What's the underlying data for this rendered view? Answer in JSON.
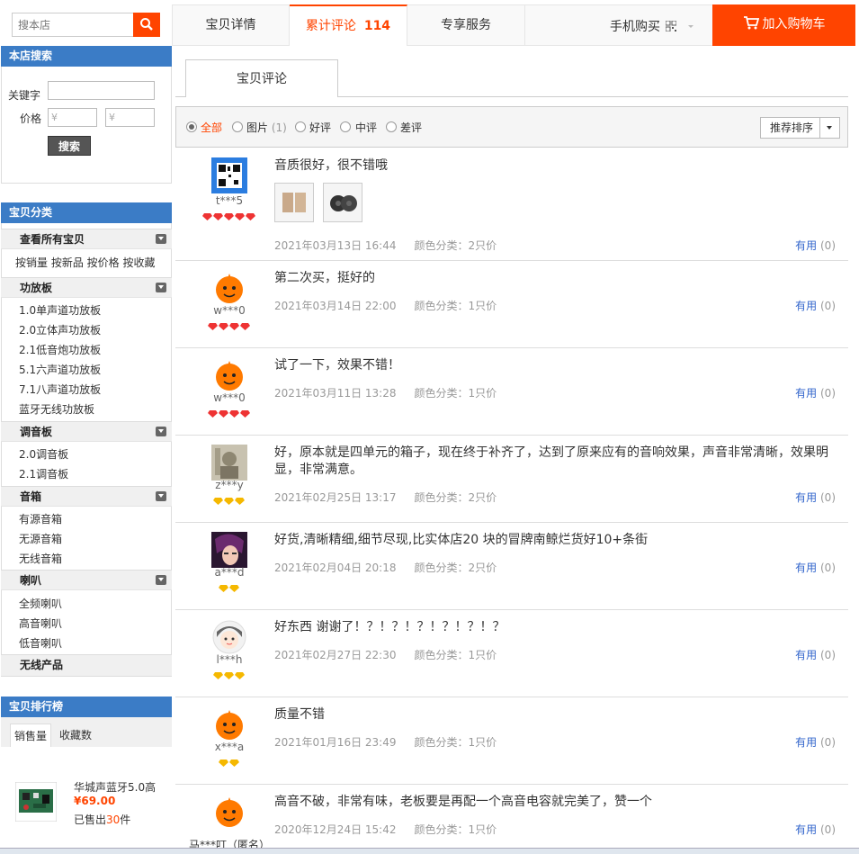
{
  "left": {
    "search_placeholder": "搜本店",
    "shop_search": {
      "title": "本店搜索",
      "keyword_label": "关键字",
      "price_label": "价格",
      "price_min_placeholder": "¥",
      "price_max_placeholder": "¥",
      "button": "搜索"
    },
    "category": {
      "title": "宝贝分类",
      "all_items": "查看所有宝贝",
      "sort_links": "按销量 按新品 按价格 按收藏",
      "groups": [
        {
          "name": "功放板",
          "items": [
            "1.0单声道功放板",
            "2.0立体声功放板",
            "2.1低音炮功放板",
            "5.1六声道功放板",
            "7.1八声道功放板",
            "蓝牙无线功放板"
          ]
        },
        {
          "name": "调音板",
          "items": [
            "2.0调音板",
            "2.1调音板"
          ]
        },
        {
          "name": "音箱",
          "items": [
            "有源音箱",
            "无源音箱",
            "无线音箱"
          ]
        },
        {
          "name": "喇叭",
          "items": [
            "全频喇叭",
            "高音喇叭",
            "低音喇叭"
          ]
        },
        {
          "name": "无线产品",
          "items": []
        }
      ]
    },
    "ranking": {
      "title": "宝贝排行榜",
      "tabs": [
        "销售量",
        "收藏数"
      ],
      "item": {
        "name": "华城声蓝牙5.0高",
        "price": "¥69.00",
        "sold_prefix": "已售出",
        "sold_count": "30",
        "sold_suffix": "件"
      }
    }
  },
  "nav": {
    "tabs": [
      "宝贝详情",
      "累计评论",
      "专享服务"
    ],
    "comment_count": "114",
    "mobile_buy": "手机购买",
    "cart": "加入购物车"
  },
  "reviews_panel": {
    "sub_tab": "宝贝评论",
    "filters": {
      "all": "全部",
      "pic": "图片",
      "pic_count": "(1)",
      "good": "好评",
      "mid": "中评",
      "bad": "差评"
    },
    "sort": "推荐排序",
    "useful_label": "有用",
    "sku_prefix": "颜色分类："
  },
  "reviews": [
    {
      "user": "t***5",
      "text": "音质很好，很不错哦",
      "date": "2021年03月13日 16:44",
      "sku": "2只价",
      "useful": "(0)",
      "avatar": "qr-code",
      "gems": 5,
      "gem_color": "#e33"
    },
    {
      "user": "w***0",
      "text": "第二次买，挺好的",
      "date": "2021年03月14日 22:00",
      "sku": "1只价",
      "useful": "(0)",
      "avatar": "orange-mascot",
      "gems": 4,
      "gem_color": "#e33"
    },
    {
      "user": "w***0",
      "text": "试了一下，效果不错！",
      "date": "2021年03月11日 13:28",
      "sku": "1只价",
      "useful": "(0)",
      "avatar": "orange-mascot",
      "gems": 4,
      "gem_color": "#e33"
    },
    {
      "user": "z***y",
      "text": "好，原本就是四单元的箱子，现在终于补齐了，达到了原来应有的音响效果，声音非常清晰，效果明显，非常满意。",
      "date": "2021年02月25日 13:17",
      "sku": "2只价",
      "useful": "(0)",
      "avatar": "photo",
      "gems": 3,
      "gem_color": "#f5b800"
    },
    {
      "user": "a***d",
      "text": "好货,清晰精细,细节尽现,比实体店20 块的冒牌南鲸烂货好10+条街",
      "date": "2021年02月04日 20:18",
      "sku": "2只价",
      "useful": "(0)",
      "avatar": "anime",
      "gems": 2,
      "gem_color": "#f5b800"
    },
    {
      "user": "l***h",
      "text": "好东西 谢谢了！？！？！？！？！？！？",
      "date": "2021年02月27日 22:30",
      "sku": "1只价",
      "useful": "(0)",
      "avatar": "girl",
      "gems": 3,
      "gem_color": "#f5b800"
    },
    {
      "user": "x***a",
      "text": "质量不错",
      "date": "2021年01月16日 23:49",
      "sku": "1只价",
      "useful": "(0)",
      "avatar": "orange-mascot",
      "gems": 2,
      "gem_color": "#f5b800"
    },
    {
      "user": "马***叮（匿名）",
      "text": "高音不破，非常有味，老板要是再配一个高音电容就完美了，赞一个",
      "date": "2020年12月24日 15:42",
      "sku": "1只价",
      "useful": "(0)",
      "avatar": "orange-mascot",
      "gems": 0,
      "gem_color": "#f5b800"
    }
  ]
}
